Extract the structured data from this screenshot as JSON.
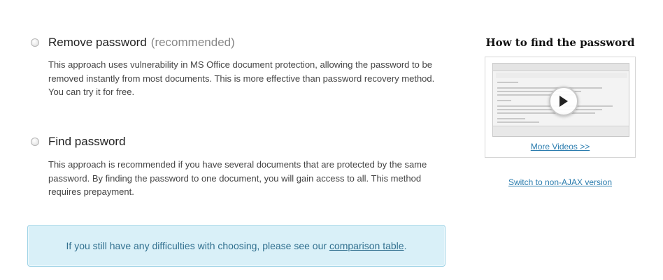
{
  "options": [
    {
      "title": "Remove password",
      "tag": "(recommended)",
      "description": "This approach uses vulnerability in MS Office document protection, allowing the password to be removed instantly from most documents. This is more effective than password recovery method. You can try it for free."
    },
    {
      "title": "Find password",
      "tag": "",
      "description": "This approach is recommended if you have several documents that are protected by the same password. By finding the password to one document, you will gain access to all. This method requires prepayment."
    }
  ],
  "notice": {
    "text_before": "If you still have any difficulties with choosing, please see our ",
    "link": "comparison table",
    "text_after": "."
  },
  "sidebar": {
    "title": "How to find the password",
    "more_videos": "More Videos >>",
    "switch_link": "Switch to non-AJAX version",
    "play_icon": "play-icon"
  }
}
